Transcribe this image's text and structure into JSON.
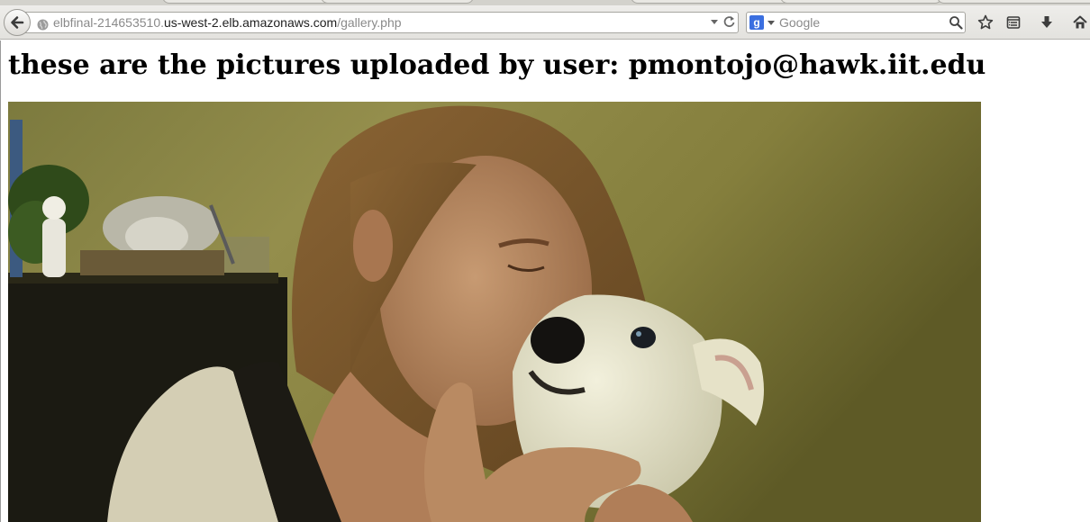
{
  "browser": {
    "url_prefix": "elbfinal-214653510.",
    "url_domain": "us-west-2.elb.amazonaws.com",
    "url_path": "/gallery.php",
    "search_engine_letter": "g",
    "search_placeholder": "Google"
  },
  "page": {
    "heading": "these are the pictures uploaded by user: pmontojo@hawk.iit.edu"
  },
  "icons": {
    "back": "back-arrow-icon",
    "site_identity": "globe-icon",
    "history_dropdown": "chevron-down-icon",
    "reload": "reload-icon",
    "search_engine": "google-icon",
    "search": "search-icon",
    "bookmark": "star-icon",
    "reading_list": "reading-list-icon",
    "downloads": "download-arrow-icon",
    "home": "home-icon"
  },
  "colors": {
    "wall": "#8a8444",
    "heading": "#000000",
    "url_text": "#8a8a8a",
    "url_domain": "#222222"
  }
}
